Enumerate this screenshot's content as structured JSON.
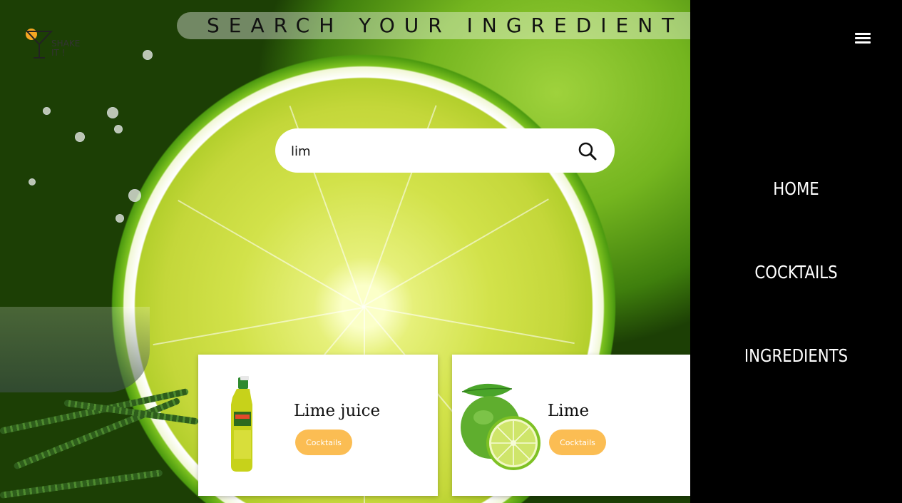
{
  "banner": {
    "title": "SEARCH YOUR INGREDIENT HERE"
  },
  "logo": {
    "line1": "SHAKE",
    "line2": "IT !"
  },
  "search": {
    "value": "lim",
    "icon": "search-icon"
  },
  "results": [
    {
      "name": "Lime juice",
      "button": "Cocktails",
      "image": "lime-juice-bottle-image"
    },
    {
      "name": "Lime",
      "button": "Cocktails",
      "image": "lime-fruit-image"
    }
  ],
  "nav": {
    "menu_icon": "hamburger-menu-icon",
    "items": [
      {
        "label": "HOME"
      },
      {
        "label": "COCKTAILS"
      },
      {
        "label": "INGREDIENTS"
      }
    ]
  },
  "colors": {
    "accent": "#fbbd53",
    "sidebar": "#000000",
    "card": "#ffffff"
  }
}
